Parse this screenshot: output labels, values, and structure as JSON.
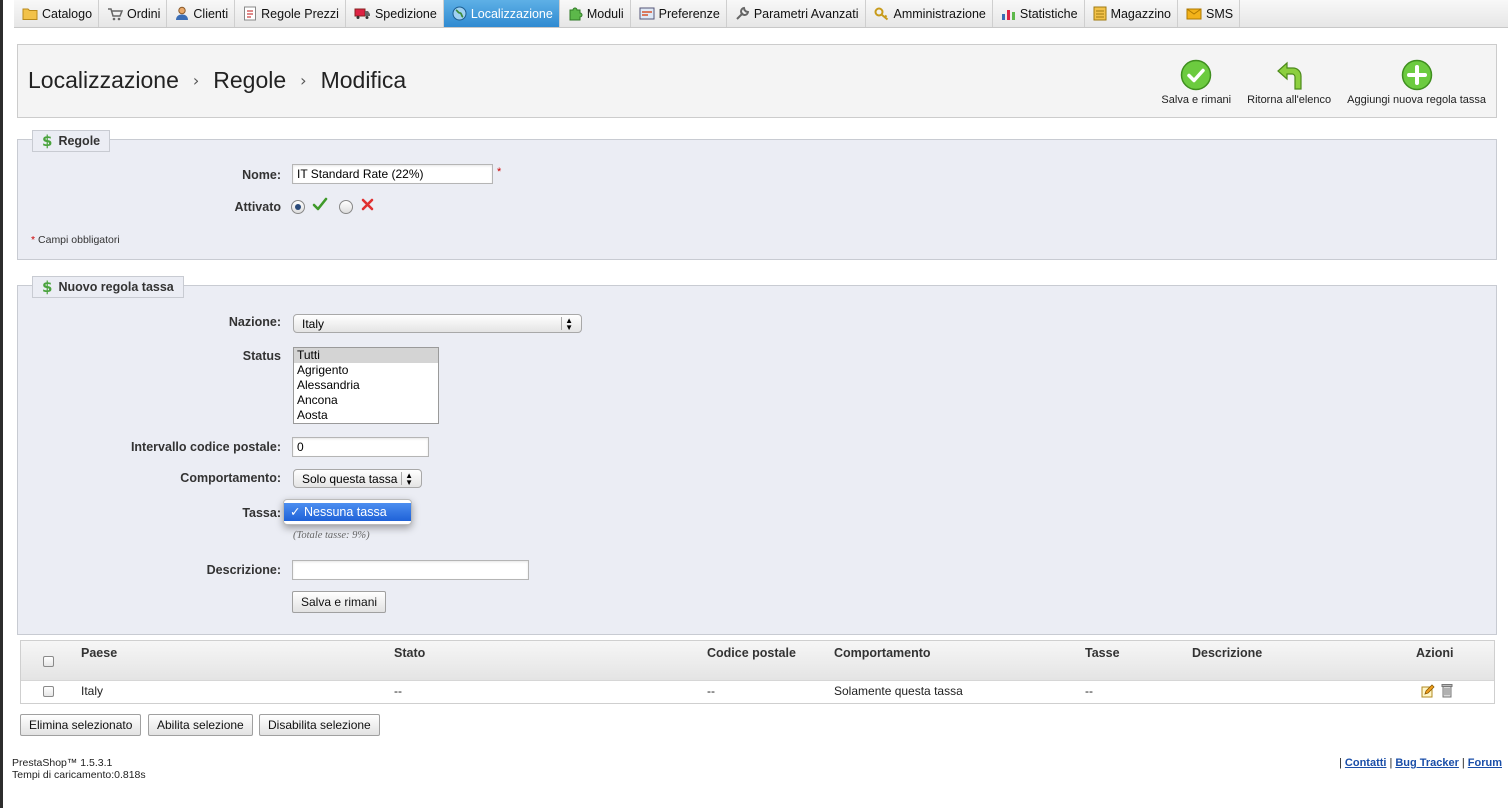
{
  "nav": {
    "tabs": [
      {
        "label": "Catalogo",
        "icon": "folder-icon"
      },
      {
        "label": "Ordini",
        "icon": "cart-icon"
      },
      {
        "label": "Clienti",
        "icon": "user-icon"
      },
      {
        "label": "Regole Prezzi",
        "icon": "price-rules-icon"
      },
      {
        "label": "Spedizione",
        "icon": "truck-icon"
      },
      {
        "label": "Localizzazione",
        "icon": "globe-icon",
        "active": true
      },
      {
        "label": "Moduli",
        "icon": "puzzle-icon"
      },
      {
        "label": "Preferenze",
        "icon": "preferences-icon"
      },
      {
        "label": "Parametri Avanzati",
        "icon": "wrench-icon"
      },
      {
        "label": "Amministrazione",
        "icon": "key-icon"
      },
      {
        "label": "Statistiche",
        "icon": "chart-icon"
      },
      {
        "label": "Magazzino",
        "icon": "warehouse-icon"
      },
      {
        "label": "SMS",
        "icon": "envelope-icon"
      }
    ]
  },
  "breadcrumb": {
    "level1": "Localizzazione",
    "level2": "Regole",
    "level3": "Modifica"
  },
  "toolbar": {
    "save_stay": "Salva e rimani",
    "back_to_list": "Ritorna all'elenco",
    "add_new_rule": "Aggiungi nuova regola tassa"
  },
  "rules_section": {
    "legend": "Regole",
    "name_label": "Nome:",
    "name_value": "IT Standard Rate (22%)",
    "required_mark": "*",
    "enabled_label": "Attivato",
    "enabled": true,
    "required_note": "Campi obbligatori"
  },
  "new_rule_section": {
    "legend": "Nuovo regola tassa",
    "country_label": "Nazione:",
    "country_value": "Italy",
    "state_label": "Status",
    "state_options": [
      "Tutti",
      "Agrigento",
      "Alessandria",
      "Ancona",
      "Aosta"
    ],
    "state_selected": "Tutti",
    "zipcode_label": "Intervallo codice postale:",
    "zipcode_value": "0",
    "behavior_label": "Comportamento:",
    "behavior_value": "Solo questa tassa",
    "tax_label": "Tassa:",
    "tax_open_option": "Nessuna tassa",
    "tax_total_note": "(Totale tasse: 9%)",
    "description_label": "Descrizione:",
    "description_value": "",
    "save_button": "Salva e rimani"
  },
  "table": {
    "headers": [
      "Paese",
      "Stato",
      "Codice postale",
      "Comportamento",
      "Tasse",
      "Descrizione",
      "Azioni"
    ],
    "rows": [
      {
        "country": "Italy",
        "state": "--",
        "zipcode": "--",
        "behavior": "Solamente questa tassa",
        "tax": "--",
        "description": ""
      }
    ]
  },
  "bulk_actions": {
    "delete": "Elimina selezionato",
    "enable": "Abilita selezione",
    "disable": "Disabilita selezione"
  },
  "footer": {
    "version": "PrestaShop™ 1.5.3.1",
    "load_time": "Tempi di caricamento:0.818s",
    "links": [
      "Contatti",
      "Bug Tracker",
      "Forum"
    ]
  },
  "colors": {
    "active_tab": "#3a96dd",
    "section_bg": "#ebedf4",
    "accent_green": "#4aa33d",
    "link": "#1a4ea8"
  }
}
